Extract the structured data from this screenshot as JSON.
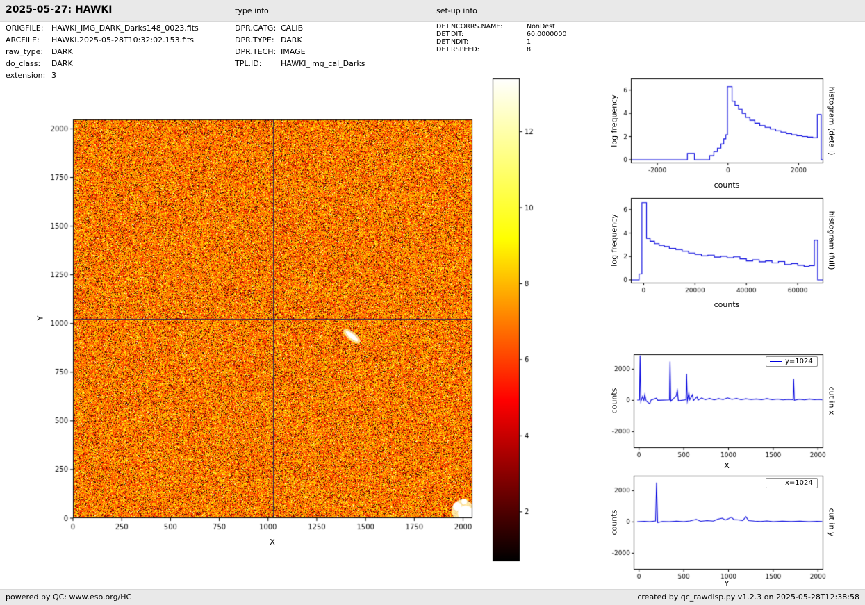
{
  "header": {
    "title": "2025-05-27: HAWKI",
    "type_info_label": "type info",
    "setup_info_label": "set-up info"
  },
  "metadata": {
    "file_info": [
      {
        "label": "ORIGFILE:",
        "value": "HAWKI_IMG_DARK_Darks148_0023.fits"
      },
      {
        "label": "ARCFILE:",
        "value": "HAWKI.2025-05-28T10:32:02.153.fits"
      },
      {
        "label": "raw_type:",
        "value": "DARK"
      },
      {
        "label": "do_class:",
        "value": "DARK"
      },
      {
        "label": "extension:",
        "value": "3"
      }
    ],
    "type_info": [
      {
        "label": "DPR.CATG:",
        "value": "CALIB"
      },
      {
        "label": "DPR.TYPE:",
        "value": "DARK"
      },
      {
        "label": "DPR.TECH:",
        "value": "IMAGE"
      },
      {
        "label": "TPL.ID:",
        "value": "HAWKI_img_cal_Darks"
      }
    ],
    "setup_info": [
      {
        "label": "DET.NCORRS.NAME:",
        "value": "NonDest"
      },
      {
        "label": "DET.DIT:",
        "value": "60.0000000"
      },
      {
        "label": "DET.NDIT:",
        "value": "1"
      },
      {
        "label": "DET.RSPEED:",
        "value": "8"
      }
    ]
  },
  "colors": {
    "bar_background": "#e9e9e9",
    "plot_line": "#0000dd",
    "colormap_name": "hot"
  },
  "footer": {
    "left": "powered by QC: www.eso.org/HC",
    "right": "created by qc_rawdisp.py v1.2.3 on 2025-05-28T12:38:58"
  },
  "chart_data": [
    {
      "id": "raw_dark_frame_image",
      "type": "heatmap",
      "description": "2048x2048 raw dark frame shown with hot colormap; orange noise field with black speckle, dark crosshair at detector center, bright streak near (1430,935) and bright patch in lower-right corner",
      "xlabel": "X",
      "ylabel": "Y",
      "xlim": [
        0,
        2048
      ],
      "ylim": [
        0,
        2048
      ],
      "xticks": [
        0,
        250,
        500,
        750,
        1000,
        1250,
        1500,
        1750,
        2000
      ],
      "yticks": [
        0,
        250,
        500,
        750,
        1000,
        1250,
        1500,
        1750,
        2000
      ],
      "colormap": "hot",
      "crosshair": {
        "x": 1024,
        "y": 1024
      },
      "colorbar": {
        "vmin": 0.7,
        "vmax": 13.4,
        "ticks": [
          2,
          4,
          6,
          8,
          10,
          12
        ]
      },
      "bright_features": [
        {
          "x": 1430,
          "y": 935,
          "shape": "streak"
        },
        {
          "x": 2020,
          "y": 25,
          "shape": "patch"
        }
      ]
    },
    {
      "id": "histogram_detail",
      "type": "line",
      "side_label": "histogram (detail)",
      "xlabel": "counts",
      "ylabel": "log frequency",
      "xlim": [
        -2750,
        2700
      ],
      "ylim": [
        -0.3,
        7.0
      ],
      "xticks": [
        -2000,
        0,
        2000
      ],
      "yticks": [
        0,
        2,
        4,
        6
      ],
      "color": "#0000dd",
      "points": [
        [
          -2750,
          0
        ],
        [
          -1150,
          0
        ],
        [
          -1150,
          0.55
        ],
        [
          -950,
          0.55
        ],
        [
          -950,
          0
        ],
        [
          -520,
          0
        ],
        [
          -520,
          0.35
        ],
        [
          -400,
          0.35
        ],
        [
          -400,
          0.7
        ],
        [
          -300,
          0.7
        ],
        [
          -300,
          1.0
        ],
        [
          -200,
          1.0
        ],
        [
          -200,
          1.35
        ],
        [
          -120,
          1.35
        ],
        [
          -120,
          1.8
        ],
        [
          -60,
          1.8
        ],
        [
          -60,
          2.15
        ],
        [
          -15,
          2.15
        ],
        [
          -15,
          6.3
        ],
        [
          115,
          6.3
        ],
        [
          115,
          5.05
        ],
        [
          200,
          5.05
        ],
        [
          200,
          4.7
        ],
        [
          300,
          4.7
        ],
        [
          300,
          4.35
        ],
        [
          400,
          4.35
        ],
        [
          400,
          4.0
        ],
        [
          500,
          4.0
        ],
        [
          500,
          3.65
        ],
        [
          620,
          3.65
        ],
        [
          620,
          3.4
        ],
        [
          760,
          3.4
        ],
        [
          760,
          3.15
        ],
        [
          900,
          3.15
        ],
        [
          900,
          2.95
        ],
        [
          1050,
          2.95
        ],
        [
          1050,
          2.8
        ],
        [
          1200,
          2.8
        ],
        [
          1200,
          2.65
        ],
        [
          1350,
          2.65
        ],
        [
          1350,
          2.5
        ],
        [
          1500,
          2.5
        ],
        [
          1500,
          2.38
        ],
        [
          1650,
          2.38
        ],
        [
          1650,
          2.25
        ],
        [
          1800,
          2.25
        ],
        [
          1800,
          2.15
        ],
        [
          1950,
          2.15
        ],
        [
          1950,
          2.07
        ],
        [
          2100,
          2.07
        ],
        [
          2100,
          2.0
        ],
        [
          2250,
          2.0
        ],
        [
          2250,
          1.95
        ],
        [
          2400,
          1.95
        ],
        [
          2400,
          1.9
        ],
        [
          2530,
          1.9
        ],
        [
          2530,
          3.9
        ],
        [
          2640,
          3.9
        ],
        [
          2640,
          0
        ],
        [
          2700,
          0
        ]
      ]
    },
    {
      "id": "histogram_full",
      "type": "line",
      "side_label": "histogram (full)",
      "xlabel": "counts",
      "ylabel": "log frequency",
      "xlim": [
        -5000,
        70000
      ],
      "ylim": [
        -0.3,
        7.0
      ],
      "xticks": [
        0,
        20000,
        40000,
        60000
      ],
      "yticks": [
        0,
        2,
        4,
        6
      ],
      "color": "#0000dd",
      "points": [
        [
          -5000,
          0
        ],
        [
          -1800,
          0
        ],
        [
          -1800,
          0.5
        ],
        [
          -700,
          0.5
        ],
        [
          -700,
          6.6
        ],
        [
          1100,
          6.6
        ],
        [
          1100,
          3.55
        ],
        [
          2500,
          3.55
        ],
        [
          2500,
          3.3
        ],
        [
          4200,
          3.3
        ],
        [
          4200,
          3.1
        ],
        [
          6000,
          3.1
        ],
        [
          6000,
          2.95
        ],
        [
          8000,
          2.95
        ],
        [
          8000,
          2.85
        ],
        [
          10000,
          2.85
        ],
        [
          10000,
          2.7
        ],
        [
          12500,
          2.7
        ],
        [
          12500,
          2.6
        ],
        [
          15000,
          2.6
        ],
        [
          15000,
          2.45
        ],
        [
          17500,
          2.45
        ],
        [
          17500,
          2.3
        ],
        [
          20000,
          2.3
        ],
        [
          20000,
          2.18
        ],
        [
          22500,
          2.18
        ],
        [
          22500,
          2.05
        ],
        [
          25000,
          2.05
        ],
        [
          25000,
          2.12
        ],
        [
          27500,
          2.12
        ],
        [
          27500,
          1.95
        ],
        [
          30000,
          1.95
        ],
        [
          30000,
          2.02
        ],
        [
          32500,
          2.02
        ],
        [
          32500,
          1.9
        ],
        [
          35000,
          1.9
        ],
        [
          35000,
          1.97
        ],
        [
          37500,
          1.97
        ],
        [
          37500,
          1.8
        ],
        [
          40000,
          1.8
        ],
        [
          40000,
          1.62
        ],
        [
          42500,
          1.62
        ],
        [
          42500,
          1.72
        ],
        [
          45000,
          1.72
        ],
        [
          45000,
          1.55
        ],
        [
          47500,
          1.55
        ],
        [
          47500,
          1.62
        ],
        [
          50000,
          1.62
        ],
        [
          50000,
          1.45
        ],
        [
          52500,
          1.45
        ],
        [
          52500,
          1.57
        ],
        [
          55000,
          1.57
        ],
        [
          55000,
          1.32
        ],
        [
          57500,
          1.32
        ],
        [
          57500,
          1.4
        ],
        [
          60000,
          1.4
        ],
        [
          60000,
          1.25
        ],
        [
          62500,
          1.25
        ],
        [
          62500,
          1.15
        ],
        [
          64500,
          1.15
        ],
        [
          64500,
          1.22
        ],
        [
          66500,
          1.22
        ],
        [
          66500,
          3.4
        ],
        [
          67800,
          3.4
        ],
        [
          67800,
          0
        ],
        [
          70000,
          0
        ]
      ]
    },
    {
      "id": "cut_in_x",
      "type": "line",
      "side_label": "cut in x",
      "legend": "y=1024",
      "xlabel": "X",
      "ylabel": "counts",
      "xlim": [
        -60,
        2060
      ],
      "ylim": [
        -3050,
        2950
      ],
      "xticks": [
        0,
        500,
        1000,
        1500,
        2000
      ],
      "yticks": [
        -2000,
        0,
        2000
      ],
      "color": "#0000dd",
      "points": [
        [
          -20,
          20
        ],
        [
          5,
          30
        ],
        [
          12,
          2870
        ],
        [
          20,
          -80
        ],
        [
          40,
          250
        ],
        [
          55,
          0
        ],
        [
          65,
          380
        ],
        [
          80,
          -40
        ],
        [
          120,
          -220
        ],
        [
          135,
          20
        ],
        [
          195,
          140
        ],
        [
          210,
          0
        ],
        [
          340,
          30
        ],
        [
          347,
          2480
        ],
        [
          355,
          -60
        ],
        [
          415,
          280
        ],
        [
          428,
          640
        ],
        [
          440,
          -30
        ],
        [
          525,
          40
        ],
        [
          532,
          1700
        ],
        [
          540,
          -50
        ],
        [
          557,
          470
        ],
        [
          567,
          30
        ],
        [
          597,
          360
        ],
        [
          608,
          -20
        ],
        [
          648,
          230
        ],
        [
          660,
          10
        ],
        [
          700,
          160
        ],
        [
          740,
          40
        ],
        [
          790,
          120
        ],
        [
          840,
          30
        ],
        [
          890,
          110
        ],
        [
          940,
          50
        ],
        [
          990,
          160
        ],
        [
          1040,
          60
        ],
        [
          1090,
          130
        ],
        [
          1140,
          40
        ],
        [
          1195,
          100
        ],
        [
          1255,
          50
        ],
        [
          1310,
          90
        ],
        [
          1370,
          40
        ],
        [
          1430,
          110
        ],
        [
          1490,
          40
        ],
        [
          1550,
          80
        ],
        [
          1610,
          30
        ],
        [
          1670,
          60
        ],
        [
          1722,
          40
        ],
        [
          1728,
          1380
        ],
        [
          1736,
          0
        ],
        [
          1790,
          70
        ],
        [
          1850,
          30
        ],
        [
          1905,
          90
        ],
        [
          1960,
          40
        ],
        [
          2020,
          60
        ],
        [
          2048,
          30
        ]
      ]
    },
    {
      "id": "cut_in_y",
      "type": "line",
      "side_label": "cut in y",
      "legend": "x=1024",
      "xlabel": "Y",
      "ylabel": "counts",
      "xlim": [
        -60,
        2060
      ],
      "ylim": [
        -3050,
        2950
      ],
      "xticks": [
        0,
        500,
        1000,
        1500,
        2000
      ],
      "yticks": [
        -2000,
        0,
        2000
      ],
      "color": "#0000dd",
      "points": [
        [
          -20,
          20
        ],
        [
          60,
          40
        ],
        [
          120,
          20
        ],
        [
          185,
          60
        ],
        [
          196,
          2520
        ],
        [
          208,
          -40
        ],
        [
          260,
          30
        ],
        [
          340,
          20
        ],
        [
          420,
          50
        ],
        [
          500,
          20
        ],
        [
          570,
          60
        ],
        [
          640,
          160
        ],
        [
          690,
          40
        ],
        [
          760,
          80
        ],
        [
          830,
          50
        ],
        [
          880,
          170
        ],
        [
          930,
          240
        ],
        [
          965,
          120
        ],
        [
          1000,
          200
        ],
        [
          1030,
          300
        ],
        [
          1060,
          150
        ],
        [
          1110,
          130
        ],
        [
          1160,
          90
        ],
        [
          1195,
          330
        ],
        [
          1225,
          80
        ],
        [
          1290,
          50
        ],
        [
          1360,
          30
        ],
        [
          1430,
          60
        ],
        [
          1500,
          20
        ],
        [
          1600,
          50
        ],
        [
          1700,
          30
        ],
        [
          1800,
          50
        ],
        [
          1900,
          20
        ],
        [
          1990,
          40
        ],
        [
          2048,
          30
        ]
      ]
    }
  ]
}
